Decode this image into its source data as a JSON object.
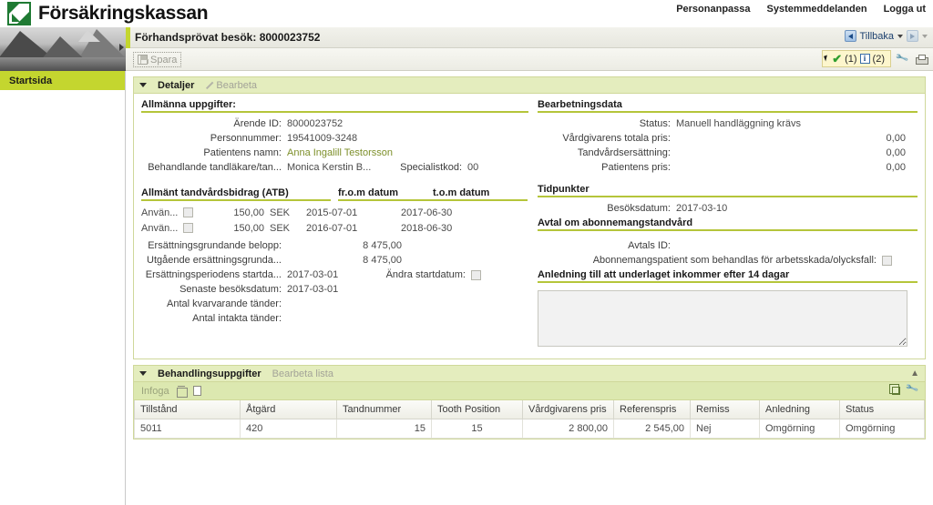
{
  "brand": {
    "name": "Försäkringskassan",
    "logo_icon": "fk-logo-icon"
  },
  "topnav": [
    {
      "label": "Personanpassa"
    },
    {
      "label": "Systemmeddelanden"
    },
    {
      "label": "Logga ut"
    }
  ],
  "sidebar": {
    "photo_alt": "mountain-lake-photo",
    "items": [
      {
        "label": "Startsida"
      }
    ],
    "collapse_icon": "collapse-arrow-icon"
  },
  "page": {
    "title": "Förhandsprövat besök: 8000023752",
    "nav": {
      "back_label": "Tillbaka",
      "back_icon": "back-arrow-icon",
      "forward_icon": "forward-arrow-icon",
      "dropdown_icon": "chevron-down-icon"
    }
  },
  "toolbar": {
    "save_label": "Spara",
    "save_icon": "save-disk-icon",
    "messages": {
      "check_icon": "green-check-icon",
      "check_count": "(1)",
      "info_icon": "info-icon",
      "info_count": "(2)",
      "info_glyph": "i"
    },
    "wrench_icon": "wrench-icon",
    "print_icon": "printer-icon"
  },
  "details_panel": {
    "title": "Detaljer",
    "edit_label": "Bearbeta",
    "edit_icon": "pencil-icon",
    "twisty_icon": "triangle-down-icon",
    "general": {
      "section_title": "Allmänna uppgifter:",
      "fields": [
        {
          "label": "Ärende ID:",
          "value": "8000023752"
        },
        {
          "label": "Personnummer:",
          "value": "19541009-3248"
        },
        {
          "label": "Patientens namn:",
          "value": "Anna Ingalill Testorsson",
          "link": true
        },
        {
          "label": "Behandlande tandläkare/tan...",
          "value": "Monica Kerstin B..."
        }
      ],
      "specialist": {
        "label": "Specialistkod:",
        "value": "00"
      }
    },
    "atb": {
      "section_title": "Allmänt tandvårdsbidrag (ATB)",
      "col_from": "fr.o.m datum",
      "col_to": "t.o.m datum",
      "rows": [
        {
          "label": "Använ...",
          "checked": false,
          "amount": "150,00",
          "currency": "SEK",
          "from": "2015-07-01",
          "to": "2017-06-30"
        },
        {
          "label": "Använ...",
          "checked": false,
          "amount": "150,00",
          "currency": "SEK",
          "from": "2016-07-01",
          "to": "2018-06-30"
        }
      ],
      "summary": [
        {
          "label": "Ersättningsgrundande belopp:",
          "value": "8 475,00"
        },
        {
          "label": "Utgående ersättningsgrunda...",
          "value": "8 475,00"
        }
      ],
      "start_date": {
        "label": "Ersättningsperiodens startda...",
        "value": "2017-03-01"
      },
      "change_start": {
        "label": "Ändra startdatum:",
        "checked": false
      },
      "extra": [
        {
          "label": "Senaste besöksdatum:",
          "value": "2017-03-01"
        },
        {
          "label": "Antal kvarvarande tänder:",
          "value": ""
        },
        {
          "label": "Antal intakta tänder:",
          "value": ""
        }
      ]
    },
    "processing": {
      "section_title": "Bearbetningsdata",
      "status": {
        "label": "Status:",
        "value": "Manuell handläggning krävs"
      },
      "amounts": [
        {
          "label": "Vårdgivarens totala pris:",
          "value": "0,00"
        },
        {
          "label": "Tandvårdsersättning:",
          "value": "0,00"
        },
        {
          "label": "Patientens pris:",
          "value": "0,00"
        }
      ]
    },
    "timepoints": {
      "section_title": "Tidpunkter",
      "visit_date": {
        "label": "Besöksdatum:",
        "value": "2017-03-10"
      }
    },
    "subscription": {
      "section_title": "Avtal om abonnemangstandvård",
      "agreement_id": {
        "label": "Avtals ID:",
        "value": ""
      },
      "work_injury": {
        "label": "Abonnemangspatient som behandlas för arbetsskada/olycksfall:",
        "checked": false
      }
    },
    "reason": {
      "section_title": "Anledning till att underlaget inkommer efter 14 dagar",
      "text": "",
      "placeholder": ""
    }
  },
  "treatment_panel": {
    "title": "Behandlingsuppgifter",
    "edit_list_label": "Bearbeta lista",
    "twisty_icon": "triangle-down-icon",
    "collapse_icon": "collapse-panel-icon",
    "list_toolbar": {
      "insert_label": "Infoga",
      "delete_icon": "trash-icon",
      "copy_icon": "copy-page-icon",
      "export_icon": "export-stack-icon",
      "settings_icon": "wrench-icon"
    },
    "columns": [
      "Tillstånd",
      "Åtgärd",
      "Tandnummer",
      "Tooth Position",
      "Vårdgivarens pris",
      "Referenspris",
      "Remiss",
      "Anledning",
      "Status"
    ],
    "rows": [
      {
        "tillstand": "5011",
        "atgard": "420",
        "tandnummer": "15",
        "tooth_position": "15",
        "vardgivarens_pris": "2 800,00",
        "referenspris": "2 545,00",
        "remiss": "Nej",
        "anledning": "Omgörning",
        "status": "Omgörning"
      }
    ]
  },
  "colors": {
    "brand_green": "#1f7a33",
    "accent_lime": "#c4d62f",
    "panel_head": "#e4edbe",
    "panel_border": "#cfd89a",
    "section_rule": "#b5c53a",
    "link_olive": "#7d8f2a",
    "msg_yellow": "#fdf6cd"
  }
}
